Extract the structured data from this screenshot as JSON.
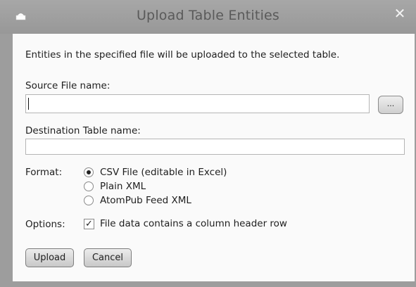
{
  "window": {
    "title": "Upload Table Entities",
    "icon": "window-icon",
    "close_glyph": "✕"
  },
  "description": "Entities in the specified file will be uploaded to the selected table.",
  "source_file": {
    "label": "Source File name:",
    "value": "",
    "browse_label": "..."
  },
  "destination_table": {
    "label": "Destination Table name:",
    "value": ""
  },
  "format": {
    "label": "Format:",
    "options": [
      {
        "label": "CSV File (editable in Excel)",
        "selected": true
      },
      {
        "label": "Plain XML",
        "selected": false
      },
      {
        "label": "AtomPub Feed XML",
        "selected": false
      }
    ]
  },
  "options": {
    "label": "Options:",
    "header_row_label": "File data contains a column header row",
    "header_row_checked": true,
    "check_glyph": "✓"
  },
  "buttons": {
    "upload": "Upload",
    "cancel": "Cancel"
  }
}
